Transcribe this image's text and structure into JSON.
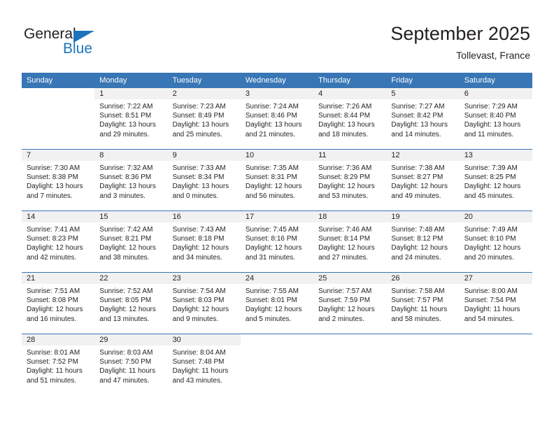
{
  "logo": {
    "word1": "General",
    "word2": "Blue",
    "triangle_icon": "triangle-icon",
    "accent_color": "#1c75bc"
  },
  "header": {
    "title": "September 2025",
    "location": "Tollevast, France"
  },
  "table": {
    "header_bg": "#3876b5",
    "daynum_bg": "#f1f1f1",
    "columns": [
      "Sunday",
      "Monday",
      "Tuesday",
      "Wednesday",
      "Thursday",
      "Friday",
      "Saturday"
    ]
  },
  "weeks": [
    [
      {
        "blank": true
      },
      {
        "day": "1",
        "sunrise": "Sunrise: 7:22 AM",
        "sunset": "Sunset: 8:51 PM",
        "daylight1": "Daylight: 13 hours",
        "daylight2": "and 29 minutes."
      },
      {
        "day": "2",
        "sunrise": "Sunrise: 7:23 AM",
        "sunset": "Sunset: 8:49 PM",
        "daylight1": "Daylight: 13 hours",
        "daylight2": "and 25 minutes."
      },
      {
        "day": "3",
        "sunrise": "Sunrise: 7:24 AM",
        "sunset": "Sunset: 8:46 PM",
        "daylight1": "Daylight: 13 hours",
        "daylight2": "and 21 minutes."
      },
      {
        "day": "4",
        "sunrise": "Sunrise: 7:26 AM",
        "sunset": "Sunset: 8:44 PM",
        "daylight1": "Daylight: 13 hours",
        "daylight2": "and 18 minutes."
      },
      {
        "day": "5",
        "sunrise": "Sunrise: 7:27 AM",
        "sunset": "Sunset: 8:42 PM",
        "daylight1": "Daylight: 13 hours",
        "daylight2": "and 14 minutes."
      },
      {
        "day": "6",
        "sunrise": "Sunrise: 7:29 AM",
        "sunset": "Sunset: 8:40 PM",
        "daylight1": "Daylight: 13 hours",
        "daylight2": "and 11 minutes."
      }
    ],
    [
      {
        "day": "7",
        "sunrise": "Sunrise: 7:30 AM",
        "sunset": "Sunset: 8:38 PM",
        "daylight1": "Daylight: 13 hours",
        "daylight2": "and 7 minutes."
      },
      {
        "day": "8",
        "sunrise": "Sunrise: 7:32 AM",
        "sunset": "Sunset: 8:36 PM",
        "daylight1": "Daylight: 13 hours",
        "daylight2": "and 3 minutes."
      },
      {
        "day": "9",
        "sunrise": "Sunrise: 7:33 AM",
        "sunset": "Sunset: 8:34 PM",
        "daylight1": "Daylight: 13 hours",
        "daylight2": "and 0 minutes."
      },
      {
        "day": "10",
        "sunrise": "Sunrise: 7:35 AM",
        "sunset": "Sunset: 8:31 PM",
        "daylight1": "Daylight: 12 hours",
        "daylight2": "and 56 minutes."
      },
      {
        "day": "11",
        "sunrise": "Sunrise: 7:36 AM",
        "sunset": "Sunset: 8:29 PM",
        "daylight1": "Daylight: 12 hours",
        "daylight2": "and 53 minutes."
      },
      {
        "day": "12",
        "sunrise": "Sunrise: 7:38 AM",
        "sunset": "Sunset: 8:27 PM",
        "daylight1": "Daylight: 12 hours",
        "daylight2": "and 49 minutes."
      },
      {
        "day": "13",
        "sunrise": "Sunrise: 7:39 AM",
        "sunset": "Sunset: 8:25 PM",
        "daylight1": "Daylight: 12 hours",
        "daylight2": "and 45 minutes."
      }
    ],
    [
      {
        "day": "14",
        "sunrise": "Sunrise: 7:41 AM",
        "sunset": "Sunset: 8:23 PM",
        "daylight1": "Daylight: 12 hours",
        "daylight2": "and 42 minutes."
      },
      {
        "day": "15",
        "sunrise": "Sunrise: 7:42 AM",
        "sunset": "Sunset: 8:21 PM",
        "daylight1": "Daylight: 12 hours",
        "daylight2": "and 38 minutes."
      },
      {
        "day": "16",
        "sunrise": "Sunrise: 7:43 AM",
        "sunset": "Sunset: 8:18 PM",
        "daylight1": "Daylight: 12 hours",
        "daylight2": "and 34 minutes."
      },
      {
        "day": "17",
        "sunrise": "Sunrise: 7:45 AM",
        "sunset": "Sunset: 8:16 PM",
        "daylight1": "Daylight: 12 hours",
        "daylight2": "and 31 minutes."
      },
      {
        "day": "18",
        "sunrise": "Sunrise: 7:46 AM",
        "sunset": "Sunset: 8:14 PM",
        "daylight1": "Daylight: 12 hours",
        "daylight2": "and 27 minutes."
      },
      {
        "day": "19",
        "sunrise": "Sunrise: 7:48 AM",
        "sunset": "Sunset: 8:12 PM",
        "daylight1": "Daylight: 12 hours",
        "daylight2": "and 24 minutes."
      },
      {
        "day": "20",
        "sunrise": "Sunrise: 7:49 AM",
        "sunset": "Sunset: 8:10 PM",
        "daylight1": "Daylight: 12 hours",
        "daylight2": "and 20 minutes."
      }
    ],
    [
      {
        "day": "21",
        "sunrise": "Sunrise: 7:51 AM",
        "sunset": "Sunset: 8:08 PM",
        "daylight1": "Daylight: 12 hours",
        "daylight2": "and 16 minutes."
      },
      {
        "day": "22",
        "sunrise": "Sunrise: 7:52 AM",
        "sunset": "Sunset: 8:05 PM",
        "daylight1": "Daylight: 12 hours",
        "daylight2": "and 13 minutes."
      },
      {
        "day": "23",
        "sunrise": "Sunrise: 7:54 AM",
        "sunset": "Sunset: 8:03 PM",
        "daylight1": "Daylight: 12 hours",
        "daylight2": "and 9 minutes."
      },
      {
        "day": "24",
        "sunrise": "Sunrise: 7:55 AM",
        "sunset": "Sunset: 8:01 PM",
        "daylight1": "Daylight: 12 hours",
        "daylight2": "and 5 minutes."
      },
      {
        "day": "25",
        "sunrise": "Sunrise: 7:57 AM",
        "sunset": "Sunset: 7:59 PM",
        "daylight1": "Daylight: 12 hours",
        "daylight2": "and 2 minutes."
      },
      {
        "day": "26",
        "sunrise": "Sunrise: 7:58 AM",
        "sunset": "Sunset: 7:57 PM",
        "daylight1": "Daylight: 11 hours",
        "daylight2": "and 58 minutes."
      },
      {
        "day": "27",
        "sunrise": "Sunrise: 8:00 AM",
        "sunset": "Sunset: 7:54 PM",
        "daylight1": "Daylight: 11 hours",
        "daylight2": "and 54 minutes."
      }
    ],
    [
      {
        "day": "28",
        "sunrise": "Sunrise: 8:01 AM",
        "sunset": "Sunset: 7:52 PM",
        "daylight1": "Daylight: 11 hours",
        "daylight2": "and 51 minutes."
      },
      {
        "day": "29",
        "sunrise": "Sunrise: 8:03 AM",
        "sunset": "Sunset: 7:50 PM",
        "daylight1": "Daylight: 11 hours",
        "daylight2": "and 47 minutes."
      },
      {
        "day": "30",
        "sunrise": "Sunrise: 8:04 AM",
        "sunset": "Sunset: 7:48 PM",
        "daylight1": "Daylight: 11 hours",
        "daylight2": "and 43 minutes."
      },
      {
        "blank": true
      },
      {
        "blank": true
      },
      {
        "blank": true
      },
      {
        "blank": true
      }
    ]
  ]
}
